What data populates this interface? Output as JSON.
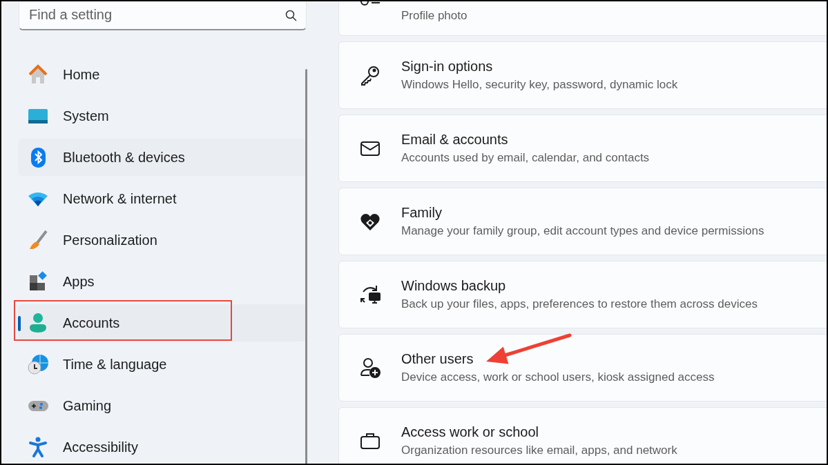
{
  "sidebar": {
    "search": {
      "placeholder": "Find a setting"
    },
    "items": [
      {
        "label": "Home",
        "kind": "home",
        "selected": false,
        "highlighted": false
      },
      {
        "label": "System",
        "kind": "system",
        "selected": false,
        "highlighted": false
      },
      {
        "label": "Bluetooth & devices",
        "kind": "bluetooth",
        "selected": false,
        "highlighted": false
      },
      {
        "label": "Network & internet",
        "kind": "network",
        "selected": false,
        "highlighted": false
      },
      {
        "label": "Personalization",
        "kind": "brush",
        "selected": false,
        "highlighted": false
      },
      {
        "label": "Apps",
        "kind": "apps",
        "selected": false,
        "highlighted": false
      },
      {
        "label": "Accounts",
        "kind": "accounts",
        "selected": true,
        "highlighted": true
      },
      {
        "label": "Time & language",
        "kind": "time",
        "selected": false,
        "highlighted": false
      },
      {
        "label": "Gaming",
        "kind": "gaming",
        "selected": false,
        "highlighted": false
      },
      {
        "label": "Accessibility",
        "kind": "accessibility",
        "selected": false,
        "highlighted": false
      }
    ]
  },
  "cards": [
    {
      "kind": "profile",
      "subtitle": "Profile photo"
    },
    {
      "kind": "key",
      "title": "Sign-in options",
      "subtitle": "Windows Hello, security key, password, dynamic lock"
    },
    {
      "kind": "mail",
      "title": "Email & accounts",
      "subtitle": "Accounts used by email, calendar, and contacts"
    },
    {
      "kind": "family",
      "title": "Family",
      "subtitle": "Manage your family group, edit account types and device permissions"
    },
    {
      "kind": "backup",
      "title": "Windows backup",
      "subtitle": "Back up your files, apps, preferences to restore them across devices"
    },
    {
      "kind": "users",
      "title": "Other users",
      "subtitle": "Device access, work or school users, kiosk assigned access",
      "pointed": true
    },
    {
      "kind": "briefcase",
      "title": "Access work or school",
      "subtitle": "Organization resources like email, apps, and network"
    }
  ]
}
